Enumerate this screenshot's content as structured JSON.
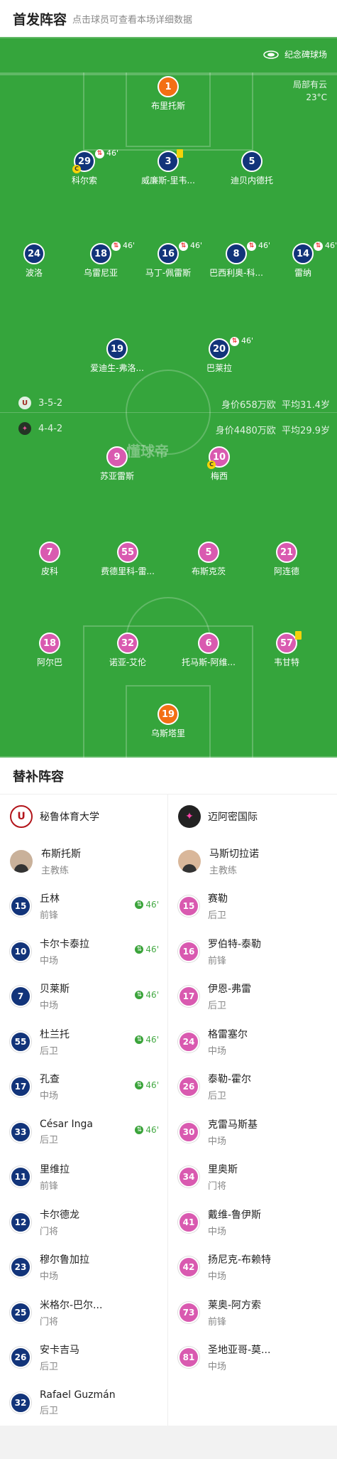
{
  "header": {
    "title": "首发阵容",
    "subtitle": "点击球员可查看本场详细数据"
  },
  "venue": "纪念碑球场",
  "weather": {
    "condition": "局部有云",
    "temp": "23°C"
  },
  "home_lineup": {
    "formation": "3-5-2",
    "value": "身价658万欧",
    "avg_age": "平均31.4岁",
    "players": [
      {
        "num": "1",
        "name": "布里托斯"
      },
      {
        "num": "29",
        "name": "科尔索",
        "sub": "46'"
      },
      {
        "num": "3",
        "name": "威廉斯-里韦..."
      },
      {
        "num": "5",
        "name": "迪贝内德托"
      },
      {
        "num": "24",
        "name": "波洛"
      },
      {
        "num": "18",
        "name": "乌雷尼亚",
        "sub": "46'"
      },
      {
        "num": "16",
        "name": "马丁-佩雷斯",
        "sub": "46'"
      },
      {
        "num": "8",
        "name": "巴西利奥-科...",
        "sub": "46'"
      },
      {
        "num": "14",
        "name": "雷纳",
        "sub": "46'"
      },
      {
        "num": "19",
        "name": "爱迪生-弗洛..."
      },
      {
        "num": "20",
        "name": "巴莱拉",
        "sub": "46'"
      }
    ]
  },
  "away_lineup": {
    "formation": "4-4-2",
    "value": "身价4480万欧",
    "avg_age": "平均29.9岁",
    "players": [
      {
        "num": "9",
        "name": "苏亚雷斯"
      },
      {
        "num": "10",
        "name": "梅西"
      },
      {
        "num": "7",
        "name": "皮科"
      },
      {
        "num": "55",
        "name": "费德里科-雷..."
      },
      {
        "num": "5",
        "name": "布斯克茨"
      },
      {
        "num": "21",
        "name": "阿连德"
      },
      {
        "num": "18",
        "name": "阿尔巴"
      },
      {
        "num": "32",
        "name": "诺亚-艾伦"
      },
      {
        "num": "6",
        "name": "托马斯-阿维..."
      },
      {
        "num": "57",
        "name": "韦甘特"
      },
      {
        "num": "19",
        "name": "乌斯塔里"
      }
    ]
  },
  "watermark": "懂球帝",
  "bench": {
    "title": "替补阵容",
    "home": {
      "team": "秘鲁体育大学",
      "coach": {
        "name": "布斯托斯",
        "role": "主教练"
      },
      "players": [
        {
          "num": "15",
          "name": "丘林",
          "pos": "前锋",
          "in": "46'"
        },
        {
          "num": "10",
          "name": "卡尔卡泰拉",
          "pos": "中场",
          "in": "46'"
        },
        {
          "num": "7",
          "name": "贝莱斯",
          "pos": "中场",
          "in": "46'"
        },
        {
          "num": "55",
          "name": "杜兰托",
          "pos": "后卫",
          "in": "46'"
        },
        {
          "num": "17",
          "name": "孔查",
          "pos": "中场",
          "in": "46'"
        },
        {
          "num": "33",
          "name": "César Inga",
          "pos": "后卫",
          "in": "46'"
        },
        {
          "num": "11",
          "name": "里维拉",
          "pos": "前锋"
        },
        {
          "num": "12",
          "name": "卡尔德龙",
          "pos": "门将"
        },
        {
          "num": "23",
          "name": "穆尔鲁加拉",
          "pos": "中场"
        },
        {
          "num": "25",
          "name": "米格尔-巴尔...",
          "pos": "门将"
        },
        {
          "num": "26",
          "name": "安卡吉马",
          "pos": "后卫"
        },
        {
          "num": "32",
          "name": "Rafael Guzmán",
          "pos": "后卫"
        }
      ]
    },
    "away": {
      "team": "迈阿密国际",
      "coach": {
        "name": "马斯切拉诺",
        "role": "主教练"
      },
      "players": [
        {
          "num": "15",
          "name": "赛勒",
          "pos": "后卫"
        },
        {
          "num": "16",
          "name": "罗伯特-泰勒",
          "pos": "前锋"
        },
        {
          "num": "17",
          "name": "伊恩-弗雷",
          "pos": "后卫"
        },
        {
          "num": "24",
          "name": "格雷塞尔",
          "pos": "中场"
        },
        {
          "num": "26",
          "name": "泰勒-霍尔",
          "pos": "后卫"
        },
        {
          "num": "30",
          "name": "克雷马斯基",
          "pos": "中场"
        },
        {
          "num": "34",
          "name": "里奥斯",
          "pos": "门将"
        },
        {
          "num": "41",
          "name": "戴维-鲁伊斯",
          "pos": "中场"
        },
        {
          "num": "42",
          "name": "扬尼克-布赖特",
          "pos": "中场"
        },
        {
          "num": "73",
          "name": "莱奥-阿方索",
          "pos": "前锋"
        },
        {
          "num": "81",
          "name": "圣地亚哥-莫...",
          "pos": "中场"
        }
      ]
    }
  }
}
